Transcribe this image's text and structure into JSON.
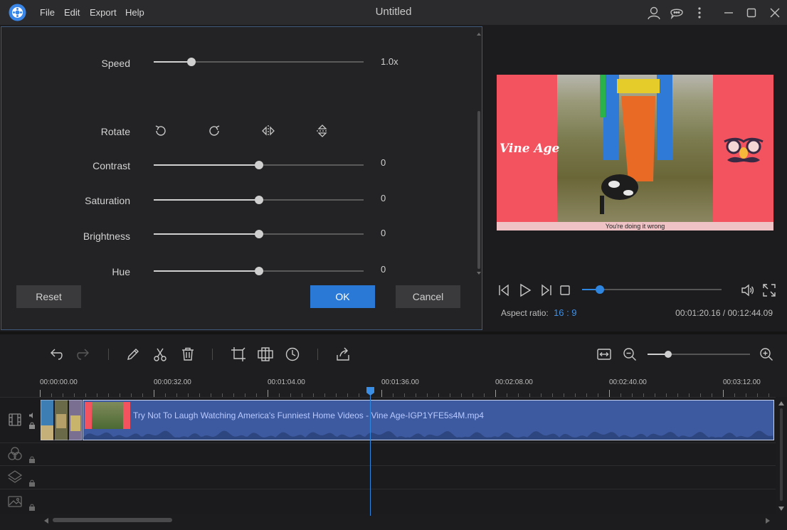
{
  "menu": {
    "file": "File",
    "edit": "Edit",
    "export": "Export",
    "help": "Help"
  },
  "window": {
    "title": "Untitled"
  },
  "icons": {
    "app": "app-logo-icon",
    "account": "user-icon",
    "feedback": "chat-icon",
    "more": "more-vertical-icon",
    "minimize": "minimize-icon",
    "maximize": "maximize-icon",
    "close": "close-icon"
  },
  "settings": {
    "speed": {
      "label": "Speed",
      "value_text": "1.0x",
      "fraction": 0.18
    },
    "rotate": {
      "label": "Rotate"
    },
    "contrast": {
      "label": "Contrast",
      "value_text": "0",
      "fraction": 0.5
    },
    "saturation": {
      "label": "Saturation",
      "value_text": "0",
      "fraction": 0.5
    },
    "brightness": {
      "label": "Brightness",
      "value_text": "0",
      "fraction": 0.5
    },
    "hue": {
      "label": "Hue",
      "value_text": "0",
      "fraction": 0.5
    },
    "reset_label": "Reset",
    "ok_label": "OK",
    "cancel_label": "Cancel"
  },
  "preview": {
    "logo_text": "Vine Age",
    "caption": "You're doing it wrong",
    "seek_fraction": 0.13,
    "aspect_label": "Aspect ratio:",
    "aspect_value": "16 : 9",
    "time_current": "00:01:20.16",
    "time_separator": " / ",
    "time_total": "00:12:44.09"
  },
  "colors": {
    "accent": "#2a79d6",
    "clip": "#3d5aa0",
    "video_bg": "#f2535f"
  },
  "timeline": {
    "ruler_labels": [
      "00:00:00.00",
      "00:00:32.00",
      "00:01:04.00",
      "00:01:36.00",
      "00:02:08.00",
      "00:02:40.00",
      "00:03:12.00"
    ],
    "zoom_fraction": 0.2,
    "clip_title": "Try Not To Laugh Watching America's Funniest Home Videos - Vine Age-IGP1YFE5s4M.mp4"
  }
}
